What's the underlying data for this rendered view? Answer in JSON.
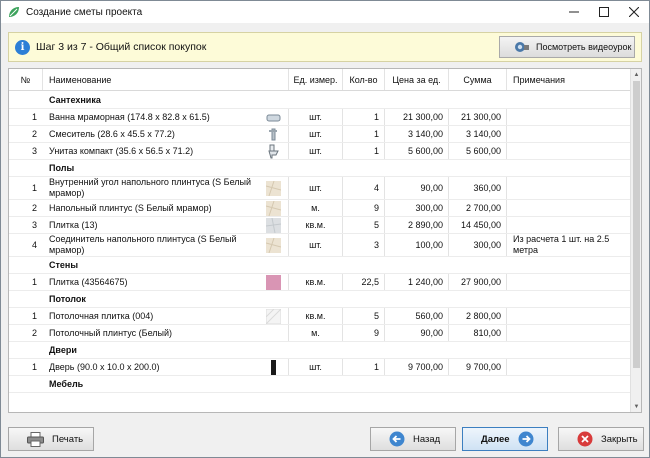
{
  "window": {
    "title": "Создание сметы проекта",
    "minimize": "—",
    "maximize": "☐",
    "close": "✕"
  },
  "info": {
    "step_text": "Шаг 3 из 7 - Общий список покупок",
    "video_button": "Посмотреть видеоурок"
  },
  "table": {
    "headers": {
      "num": "№",
      "name": "Наименование",
      "unit": "Ед. измер.",
      "qty": "Кол-во",
      "price": "Цена за ед.",
      "sum": "Сумма",
      "note": "Примечания"
    },
    "rows": [
      {
        "kind": "category",
        "name": "Сантехника"
      },
      {
        "kind": "item",
        "num": "1",
        "name": "Ванна мраморная (174.8 x 82.8 x 61.5)",
        "unit": "шт.",
        "qty": "1",
        "price": "21 300,00",
        "sum": "21 300,00",
        "note": "",
        "thumb": "bathtub"
      },
      {
        "kind": "item",
        "num": "2",
        "name": "Смеситель (28.6 x 45.5 x 77.2)",
        "unit": "шт.",
        "qty": "1",
        "price": "3 140,00",
        "sum": "3 140,00",
        "note": "",
        "thumb": "faucet"
      },
      {
        "kind": "item",
        "num": "3",
        "name": "Унитаз компакт (35.6 x 56.5 x 71.2)",
        "unit": "шт.",
        "qty": "1",
        "price": "5 600,00",
        "sum": "5 600,00",
        "note": "",
        "thumb": "toilet"
      },
      {
        "kind": "category",
        "name": "Полы"
      },
      {
        "kind": "item",
        "num": "1",
        "name": "Внутренний угол напольного плинтуса (S Белый мрамор)",
        "unit": "шт.",
        "qty": "4",
        "price": "90,00",
        "sum": "360,00",
        "note": "",
        "thumb": "marble"
      },
      {
        "kind": "item",
        "num": "2",
        "name": "Напольный плинтус (S Белый мрамор)",
        "unit": "м.",
        "qty": "9",
        "price": "300,00",
        "sum": "2 700,00",
        "note": "",
        "thumb": "marble"
      },
      {
        "kind": "item",
        "num": "3",
        "name": "Плитка (13)",
        "unit": "кв.м.",
        "qty": "5",
        "price": "2 890,00",
        "sum": "14 450,00",
        "note": "",
        "thumb": "stone"
      },
      {
        "kind": "item",
        "num": "4",
        "name": "Соединитель напольного плинтуса (S Белый мрамор)",
        "unit": "шт.",
        "qty": "3",
        "price": "100,00",
        "sum": "300,00",
        "note": "Из расчета 1 шт. на 2.5 метра",
        "thumb": "marble"
      },
      {
        "kind": "category",
        "name": "Стены"
      },
      {
        "kind": "item",
        "num": "1",
        "name": "Плитка (43564675)",
        "unit": "кв.м.",
        "qty": "22,5",
        "price": "1 240,00",
        "sum": "27 900,00",
        "note": "",
        "thumb": "pink"
      },
      {
        "kind": "category",
        "name": "Потолок"
      },
      {
        "kind": "item",
        "num": "1",
        "name": "Потолочная плитка (004)",
        "unit": "кв.м.",
        "qty": "5",
        "price": "560,00",
        "sum": "2 800,00",
        "note": "",
        "thumb": "ceiling"
      },
      {
        "kind": "item",
        "num": "2",
        "name": "Потолочный плинтус (Белый)",
        "unit": "м.",
        "qty": "9",
        "price": "90,00",
        "sum": "810,00",
        "note": "",
        "thumb": ""
      },
      {
        "kind": "category",
        "name": "Двери"
      },
      {
        "kind": "item",
        "num": "1",
        "name": "Дверь (90.0 x 10.0 x 200.0)",
        "unit": "шт.",
        "qty": "1",
        "price": "9 700,00",
        "sum": "9 700,00",
        "note": "",
        "thumb": "door"
      },
      {
        "kind": "category",
        "name": "Мебель"
      }
    ]
  },
  "buttons": {
    "print": "Печать",
    "back": "Назад",
    "next": "Далее",
    "close": "Закрыть"
  },
  "colors": {
    "info_bg": "#fdfbd8",
    "accent": "#2d7fd6",
    "close_red": "#d83b3b"
  }
}
